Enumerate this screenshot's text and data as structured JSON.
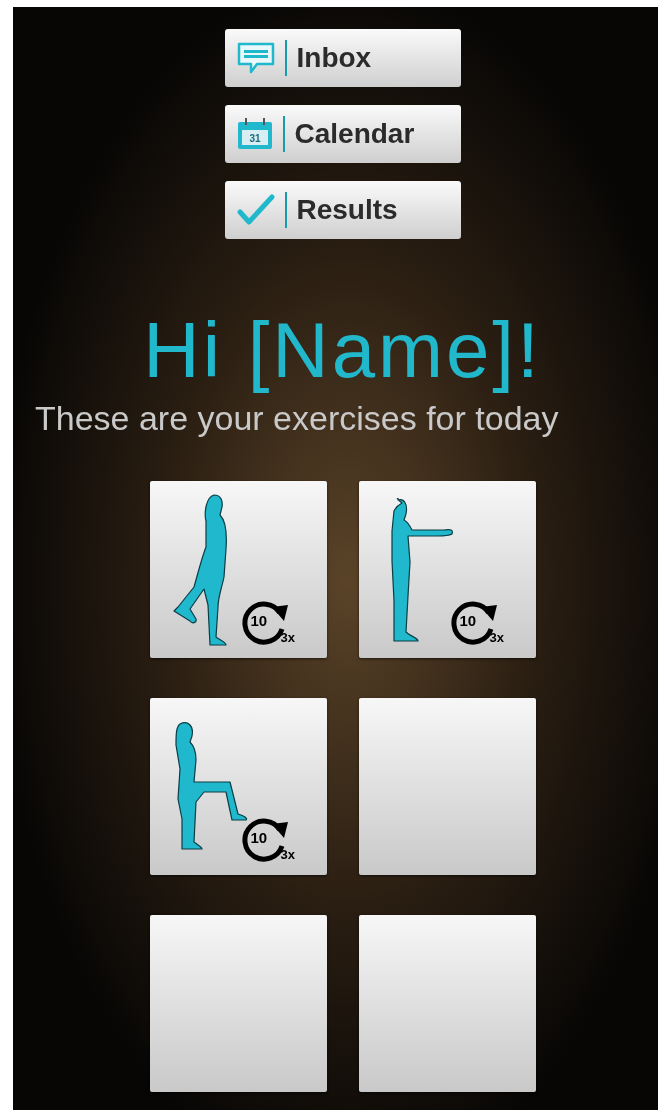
{
  "nav_buttons": [
    {
      "kind": "inbox",
      "label": "Inbox"
    },
    {
      "kind": "calendar",
      "label": "Calendar",
      "icon_text": "31"
    },
    {
      "kind": "results",
      "label": "Results"
    }
  ],
  "greeting": "Hi [Name]!",
  "subtitle": "These are your exercises for today",
  "tiles": [
    {
      "kind": "walk",
      "reps": "10",
      "sets": "3x"
    },
    {
      "kind": "reach",
      "reps": "10",
      "sets": "3x"
    },
    {
      "kind": "knee",
      "reps": "10",
      "sets": "3x"
    },
    {
      "kind": "empty"
    },
    {
      "kind": "empty"
    },
    {
      "kind": "empty"
    }
  ]
}
